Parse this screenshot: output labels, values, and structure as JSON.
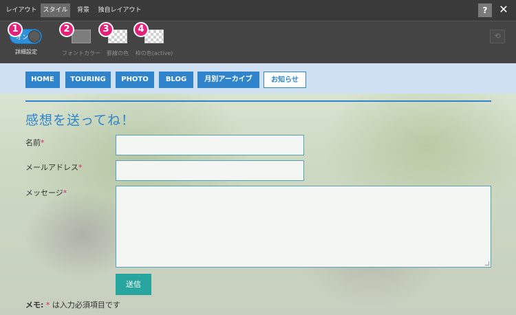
{
  "tabs": [
    {
      "label": "レイアウト",
      "active": false
    },
    {
      "label": "スタイル",
      "active": true
    },
    {
      "label": "背景",
      "active": false
    },
    {
      "label": "独自レイアウト",
      "active": false
    }
  ],
  "window": {
    "help_label": "?",
    "close_label": "✕"
  },
  "options": {
    "toggle": {
      "state_label": "オン",
      "caption": "詳細設定"
    },
    "font_color": {
      "caption": "フォントカラー",
      "color": "#7d7d7d"
    },
    "border_color": {
      "caption": "罫線の色"
    },
    "frame_color_active": {
      "caption": "枠の色(active)"
    },
    "badges": [
      "1",
      "2",
      "3",
      "4"
    ],
    "reset_icon": "⟲"
  },
  "preview": {
    "nav": [
      {
        "label": "HOME"
      },
      {
        "label": "TOURING"
      },
      {
        "label": "PHOTO"
      },
      {
        "label": "BLOG"
      },
      {
        "label": "月別アーカイブ"
      },
      {
        "label": "お知らせ",
        "current": true
      }
    ],
    "form": {
      "title": "感想を送ってね！",
      "fields": [
        {
          "label": "名前",
          "required_mark": "*",
          "value": ""
        },
        {
          "label": "メールアドレス",
          "required_mark": "*",
          "value": ""
        },
        {
          "label": "メッセージ",
          "required_mark": "*",
          "value": ""
        }
      ],
      "submit_label": "送信",
      "memo_label": "メモ:",
      "memo_mark": "*",
      "memo_text": "は入力必須項目です"
    }
  },
  "colors": {
    "accent": "#2f84cc",
    "badge": "#e3227a",
    "submit": "#27a59e"
  }
}
